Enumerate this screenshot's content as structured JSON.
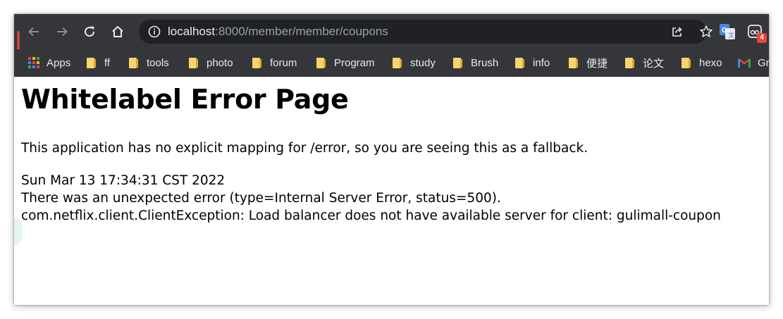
{
  "browser": {
    "url": {
      "host": "localhost",
      "rest": ":8000/member/member/coupons"
    },
    "extension_badge": "4",
    "bookmarks": [
      {
        "label": "Apps",
        "icon": "apps-grid-icon"
      },
      {
        "label": "ff",
        "icon": "folder-icon"
      },
      {
        "label": "tools",
        "icon": "folder-icon"
      },
      {
        "label": "photo",
        "icon": "folder-icon"
      },
      {
        "label": "forum",
        "icon": "folder-icon"
      },
      {
        "label": "Program",
        "icon": "folder-icon"
      },
      {
        "label": "study",
        "icon": "folder-icon"
      },
      {
        "label": "Brush",
        "icon": "folder-icon"
      },
      {
        "label": "info",
        "icon": "folder-icon"
      },
      {
        "label": "便捷",
        "icon": "folder-icon"
      },
      {
        "label": "论文",
        "icon": "folder-icon"
      },
      {
        "label": "hexo",
        "icon": "folder-icon"
      },
      {
        "label": "Gr",
        "icon": "gmail-icon"
      }
    ]
  },
  "page": {
    "title": "Whitelabel Error Page",
    "fallback_message": "This application has no explicit mapping for /error, so you are seeing this as a fallback.",
    "timestamp": "Sun Mar 13 17:34:31 CST 2022",
    "error_line": "There was an unexpected error (type=Internal Server Error, status=500).",
    "exception_line": "com.netflix.client.ClientException: Load balancer does not have available server for client: gulimall-coupon"
  },
  "colors": {
    "toolbar_bg": "#35363a",
    "omnibox_bg": "#202124",
    "folder": "#fbd46d",
    "badge": "#e8453c"
  }
}
